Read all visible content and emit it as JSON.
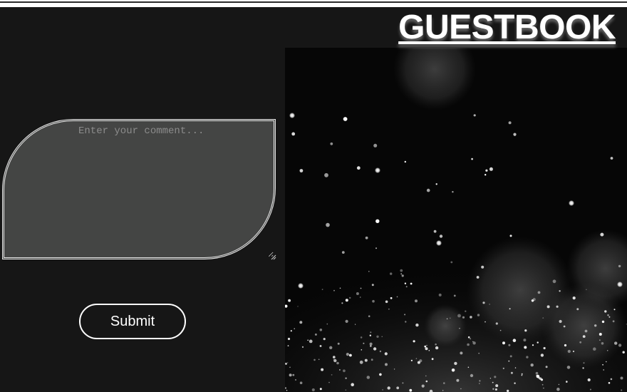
{
  "header": {
    "title": "GUESTBOOK"
  },
  "comment_form": {
    "placeholder": "Enter your comment...",
    "value": "",
    "submit_label": "Submit"
  },
  "background": {
    "description_icon": "bokeh-sparkles-image"
  },
  "colors": {
    "page_bg": "#161616",
    "textarea_bg": "#444544",
    "text": "#ffffff"
  }
}
